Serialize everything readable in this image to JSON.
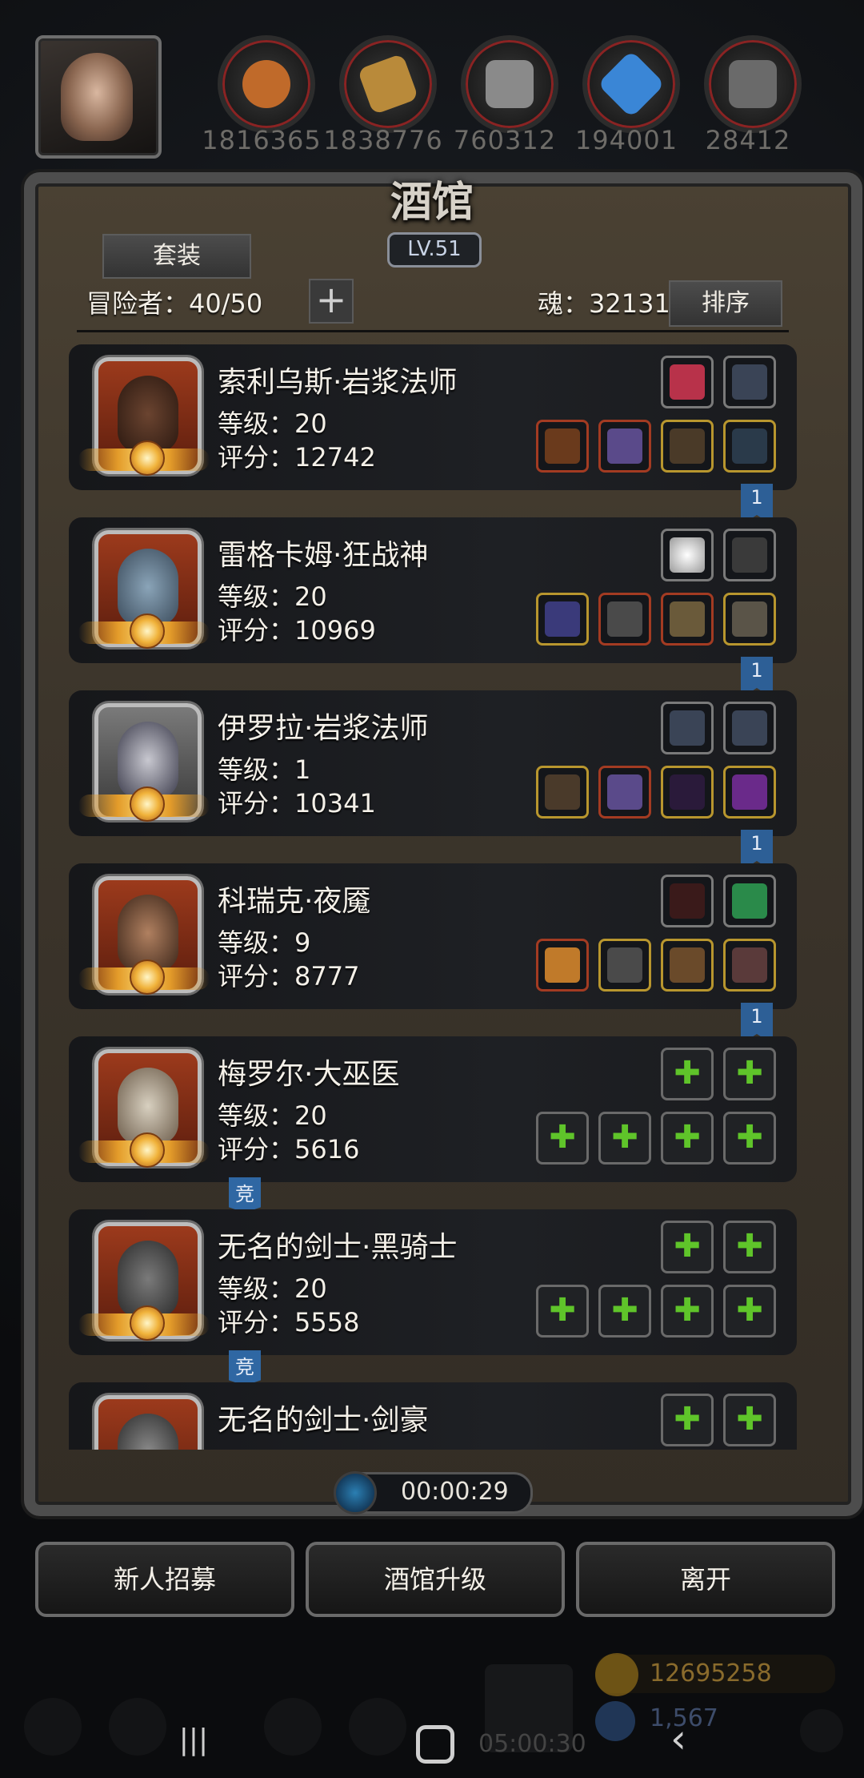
{
  "resources": [
    {
      "icon": "meat-icon",
      "value": "1816365",
      "color": "#c06a2a"
    },
    {
      "icon": "wood-icon",
      "value": "1838776",
      "color": "#b98a3a"
    },
    {
      "icon": "iron-icon",
      "value": "760312",
      "color": "#8a8a8a"
    },
    {
      "icon": "crystal-icon",
      "value": "194001",
      "color": "#3a86d6"
    },
    {
      "icon": "ore-icon",
      "value": "28412",
      "color": "#7a7a7a"
    }
  ],
  "panel": {
    "title": "酒馆",
    "level": "LV.51",
    "set_button": "套装",
    "adventurers_label": "冒险者：",
    "adventurers_count": "40/50",
    "soul_label": "魂：",
    "soul_value": "32131",
    "sort_button": "排序"
  },
  "heroes": [
    {
      "name": "索利乌斯·岩浆法师",
      "level": "等级：20",
      "score": "评分：12742",
      "tag": "1",
      "tag_type": "rank"
    },
    {
      "name": "雷格卡姆·狂战神",
      "level": "等级：20",
      "score": "评分：10969",
      "tag": "1",
      "tag_type": "rank"
    },
    {
      "name": "伊罗拉·岩浆法师",
      "level": "等级：1",
      "score": "评分：10341",
      "tag": "1",
      "tag_type": "rank"
    },
    {
      "name": "科瑞克·夜魇",
      "level": "等级：9",
      "score": "评分：8777",
      "tag": "1",
      "tag_type": "rank"
    },
    {
      "name": "梅罗尔·大巫医",
      "level": "等级：20",
      "score": "评分：5616",
      "tag": "竞",
      "tag_type": "arena"
    },
    {
      "name": "无名的剑士·黑骑士",
      "level": "等级：20",
      "score": "评分：5558",
      "tag": "竞",
      "tag_type": "arena"
    },
    {
      "name": "无名的剑士·剑豪",
      "level": "",
      "score": "",
      "tag": "",
      "tag_type": ""
    }
  ],
  "timer": "00:00:29",
  "buttons": {
    "recruit": "新人招募",
    "upgrade": "酒馆升级",
    "leave": "离开"
  },
  "background": {
    "gold": "12695258",
    "gems": "1,567",
    "clock": "05:00:30"
  }
}
